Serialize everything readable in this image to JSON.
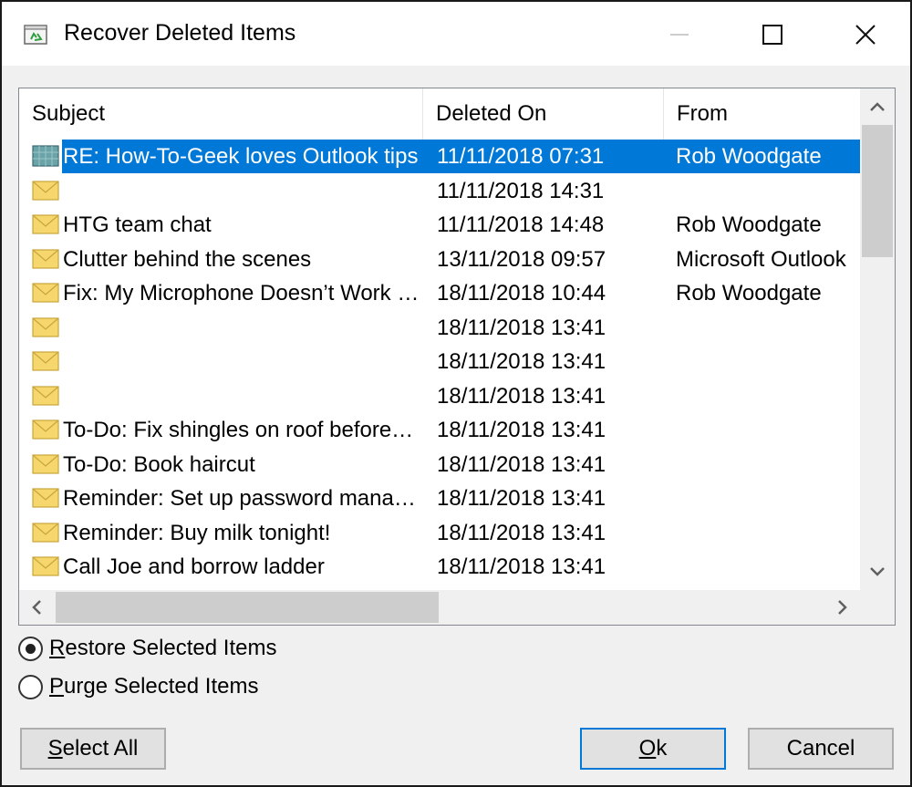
{
  "window": {
    "title": "Recover Deleted Items"
  },
  "list": {
    "columns": [
      "Subject",
      "Deleted On",
      "From"
    ],
    "rows": [
      {
        "subject": "RE: How-To-Geek loves Outlook tips",
        "deleted_on": "11/11/2018 07:31",
        "from": "Rob Woodgate",
        "selected": true,
        "icon": "meeting-reply-icon"
      },
      {
        "subject": "",
        "deleted_on": "11/11/2018 14:31",
        "from": "",
        "selected": false,
        "icon": "envelope-icon"
      },
      {
        "subject": "HTG team chat",
        "deleted_on": "11/11/2018 14:48",
        "from": "Rob Woodgate",
        "selected": false,
        "icon": "envelope-icon"
      },
      {
        "subject": "Clutter behind the scenes",
        "deleted_on": "13/11/2018 09:57",
        "from": "Microsoft Outlook",
        "selected": false,
        "icon": "envelope-icon"
      },
      {
        "subject": "Fix: My Microphone Doesn’t Work …",
        "deleted_on": "18/11/2018 10:44",
        "from": "Rob Woodgate",
        "selected": false,
        "icon": "envelope-icon"
      },
      {
        "subject": "",
        "deleted_on": "18/11/2018 13:41",
        "from": "",
        "selected": false,
        "icon": "envelope-icon"
      },
      {
        "subject": "",
        "deleted_on": "18/11/2018 13:41",
        "from": "",
        "selected": false,
        "icon": "envelope-icon"
      },
      {
        "subject": "",
        "deleted_on": "18/11/2018 13:41",
        "from": "",
        "selected": false,
        "icon": "envelope-icon"
      },
      {
        "subject": "To-Do: Fix shingles on roof before…",
        "deleted_on": "18/11/2018 13:41",
        "from": "",
        "selected": false,
        "icon": "envelope-icon"
      },
      {
        "subject": "To-Do: Book haircut",
        "deleted_on": "18/11/2018 13:41",
        "from": "",
        "selected": false,
        "icon": "envelope-icon"
      },
      {
        "subject": "Reminder: Set up password mana…",
        "deleted_on": "18/11/2018 13:41",
        "from": "",
        "selected": false,
        "icon": "envelope-icon"
      },
      {
        "subject": "Reminder: Buy milk tonight!",
        "deleted_on": "18/11/2018 13:41",
        "from": "",
        "selected": false,
        "icon": "envelope-icon"
      },
      {
        "subject": "Call Joe and borrow ladder",
        "deleted_on": "18/11/2018 13:41",
        "from": "",
        "selected": false,
        "icon": "envelope-icon"
      }
    ]
  },
  "options": {
    "restore_prefix": "R",
    "restore_rest": "estore Selected Items",
    "purge_prefix": "P",
    "purge_rest": "urge Selected Items",
    "selected": "restore"
  },
  "buttons": {
    "select_all_prefix": "S",
    "select_all_rest": "elect All",
    "ok_prefix": "O",
    "ok_rest": "k",
    "cancel": "Cancel"
  },
  "colors": {
    "selection": "#0078d7",
    "envelope": "#f5d76e"
  }
}
